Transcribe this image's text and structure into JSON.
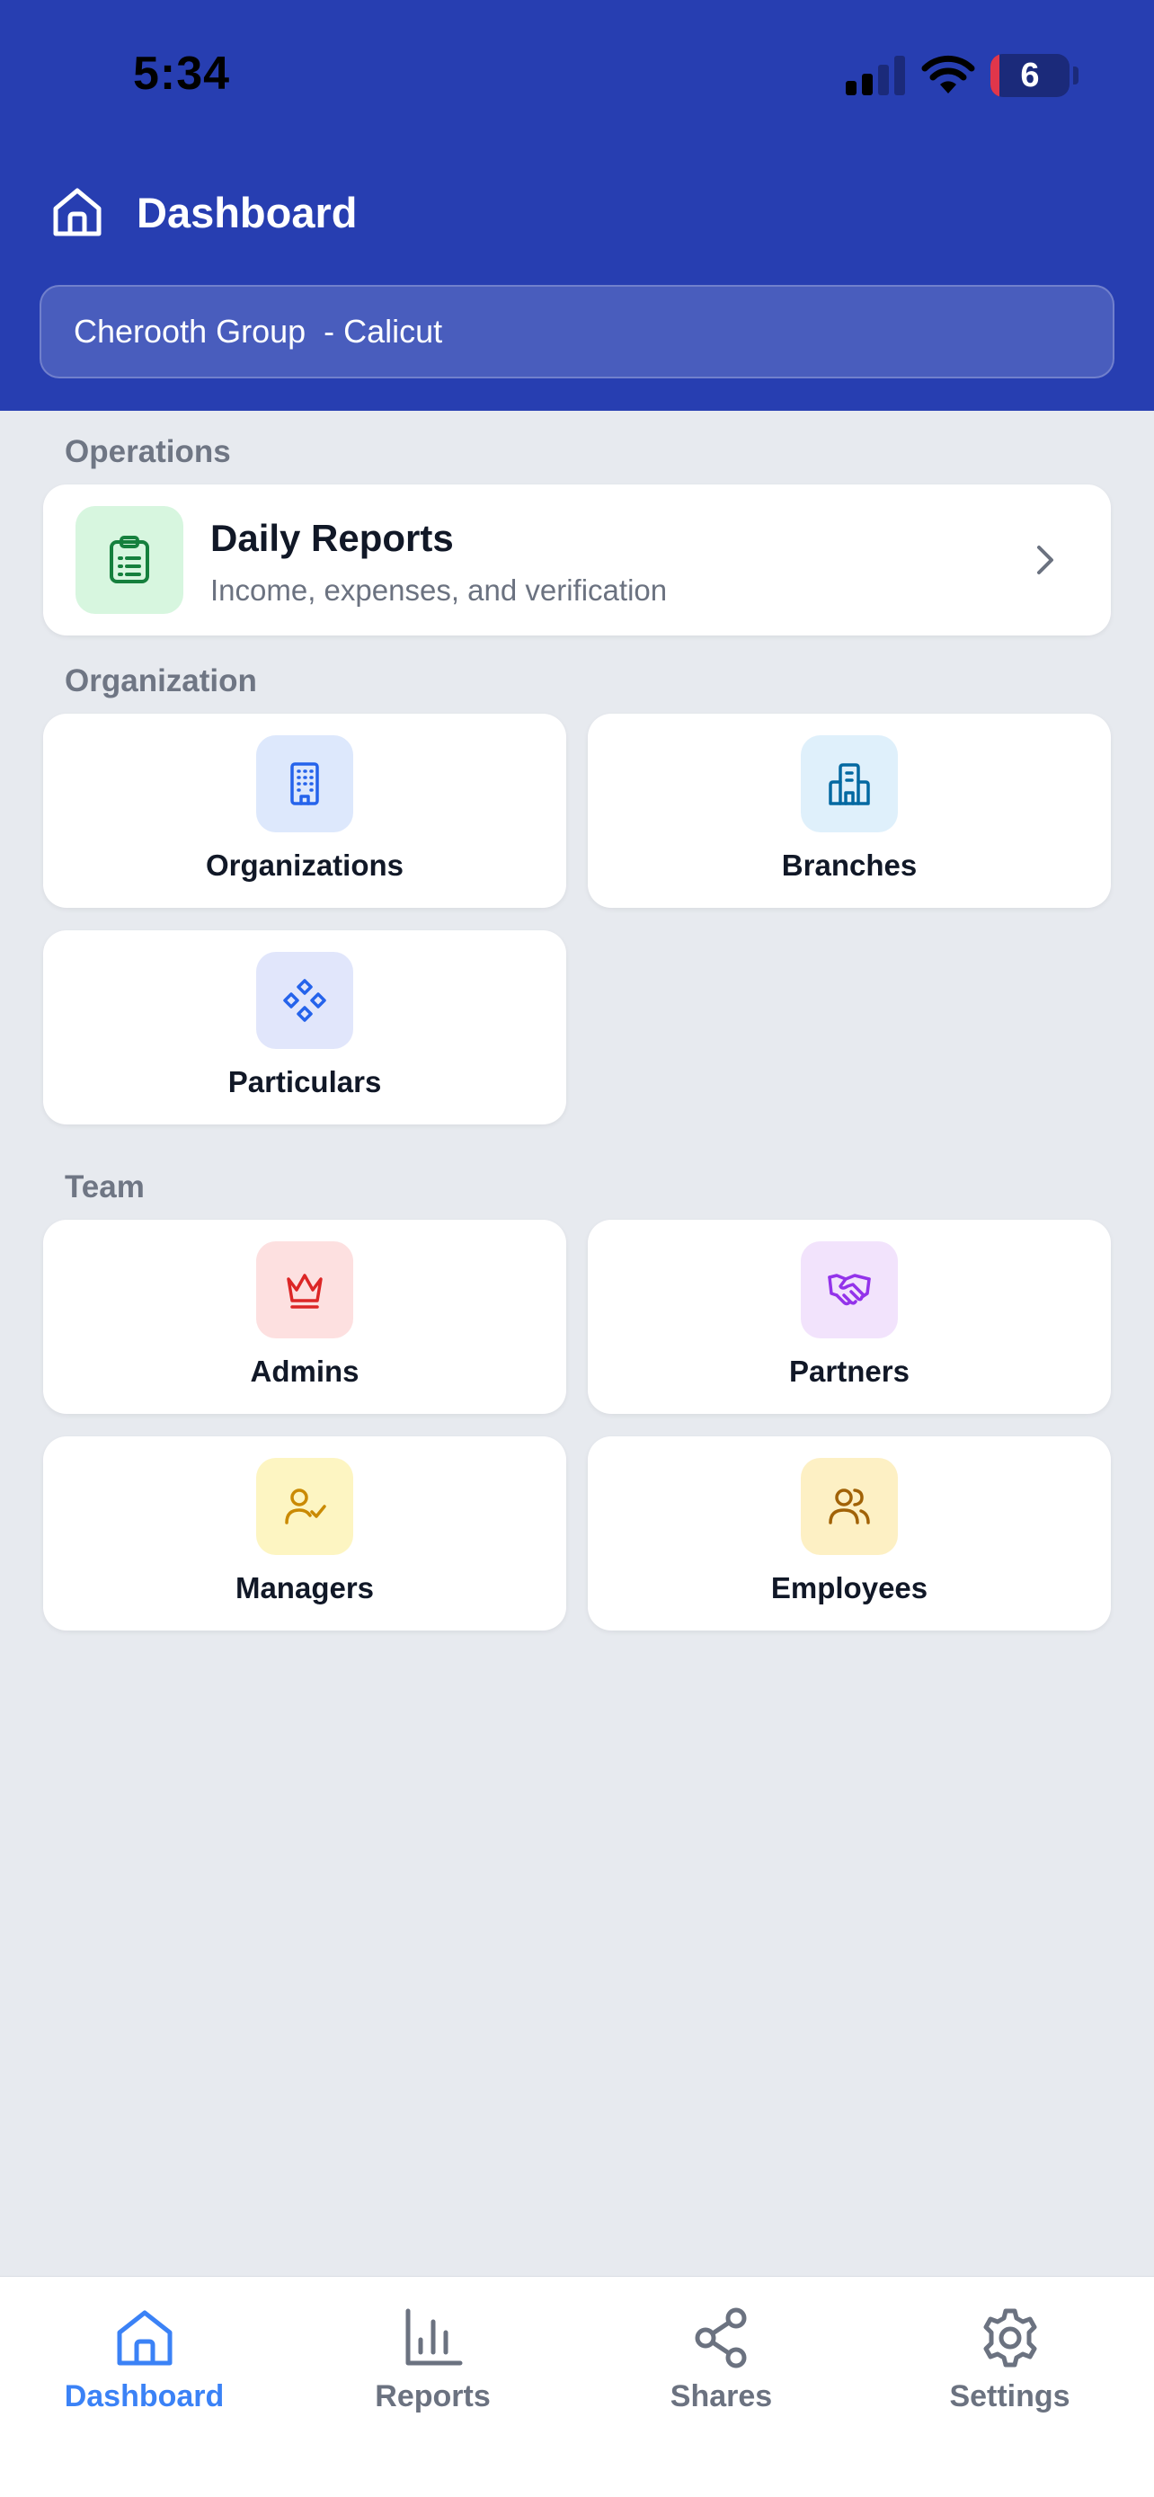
{
  "status_bar": {
    "time": "5:34",
    "battery": "6"
  },
  "header": {
    "title": "Dashboard",
    "org_selector": "Cherooth Group  - Calicut"
  },
  "sections": {
    "operations": {
      "label": "Operations",
      "daily_reports": {
        "title": "Daily Reports",
        "subtitle": "Income, expenses, and verification"
      }
    },
    "organization": {
      "label": "Organization",
      "tiles": [
        {
          "label": "Organizations",
          "icon": "building-icon"
        },
        {
          "label": "Branches",
          "icon": "branch-building-icon"
        },
        {
          "label": "Particulars",
          "icon": "diamonds-icon"
        }
      ]
    },
    "team": {
      "label": "Team",
      "tiles": [
        {
          "label": "Admins",
          "icon": "crown-icon"
        },
        {
          "label": "Partners",
          "icon": "handshake-icon"
        },
        {
          "label": "Managers",
          "icon": "user-check-icon"
        },
        {
          "label": "Employees",
          "icon": "users-icon"
        }
      ]
    }
  },
  "bottom_nav": {
    "items": [
      {
        "label": "Dashboard",
        "icon": "home-icon",
        "active": true
      },
      {
        "label": "Reports",
        "icon": "bar-chart-icon",
        "active": false
      },
      {
        "label": "Shares",
        "icon": "share-icon",
        "active": false
      },
      {
        "label": "Settings",
        "icon": "gear-icon",
        "active": false
      }
    ]
  },
  "colors": {
    "header_bg": "#273eb1",
    "page_bg": "#e7eaef",
    "accent": "#3b82f6",
    "daily_reports_icon_bg": "#d7f6df",
    "organizations_icon_bg": "#dde8fc",
    "branches_icon_bg": "#dff0fb",
    "particulars_icon_bg": "#e1e6fb",
    "admins_icon_bg": "#fde0e0",
    "partners_icon_bg": "#f2e3fc",
    "managers_icon_bg": "#fdf5c2",
    "employees_icon_bg": "#fdf0c4"
  }
}
